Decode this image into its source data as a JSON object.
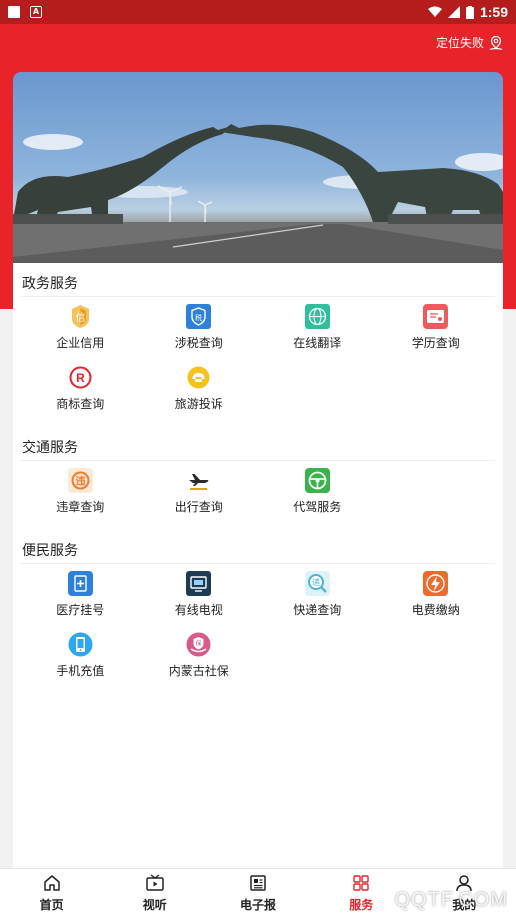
{
  "status_bar": {
    "time": "1:59"
  },
  "header": {
    "location_text": "定位失败"
  },
  "sections": [
    {
      "title": "政务服务",
      "items": [
        {
          "label": "企业信用",
          "icon": "credit-icon",
          "color": "#f0b43c"
        },
        {
          "label": "涉税查询",
          "icon": "tax-shield-icon",
          "color": "#2f80d8"
        },
        {
          "label": "在线翻译",
          "icon": "globe-icon",
          "color": "#2fbf9c"
        },
        {
          "label": "学历查询",
          "icon": "certificate-icon",
          "color": "#e85656"
        },
        {
          "label": "商标查询",
          "icon": "registered-icon",
          "color": "#e8232a"
        },
        {
          "label": "旅游投诉",
          "icon": "phone-icon",
          "color": "#f2c21b"
        }
      ]
    },
    {
      "title": "交通服务",
      "items": [
        {
          "label": "违章查询",
          "icon": "violation-icon",
          "color": "#f07b2c"
        },
        {
          "label": "出行查询",
          "icon": "airplane-icon",
          "color": "#e8a400"
        },
        {
          "label": "代驾服务",
          "icon": "steering-wheel-icon",
          "color": "#3ab44a"
        }
      ]
    },
    {
      "title": "便民服务",
      "items": [
        {
          "label": "医疗挂号",
          "icon": "medical-icon",
          "color": "#2f80d8"
        },
        {
          "label": "有线电视",
          "icon": "tv-icon",
          "color": "#1e3a55"
        },
        {
          "label": "快递查询",
          "icon": "express-icon",
          "color": "#4cb5d8"
        },
        {
          "label": "电费缴纳",
          "icon": "lightning-icon",
          "color": "#f06a2c"
        },
        {
          "label": "手机充值",
          "icon": "mobile-icon",
          "color": "#2da8f0"
        },
        {
          "label": "内蒙古社保",
          "icon": "social-security-icon",
          "color": "#d85a88"
        }
      ]
    }
  ],
  "bottom_nav": [
    {
      "label": "首页",
      "icon": "home-icon",
      "active": false
    },
    {
      "label": "视听",
      "icon": "video-icon",
      "active": false
    },
    {
      "label": "电子报",
      "icon": "newspaper-icon",
      "active": false
    },
    {
      "label": "服务",
      "icon": "grid-icon",
      "active": true
    },
    {
      "label": "我的",
      "icon": "user-icon",
      "active": false
    }
  ],
  "watermark": "QQTF.COM",
  "colors": {
    "primary": "#e8232a",
    "status_bar": "#b51c1c",
    "active_tab": "#e8232a"
  }
}
